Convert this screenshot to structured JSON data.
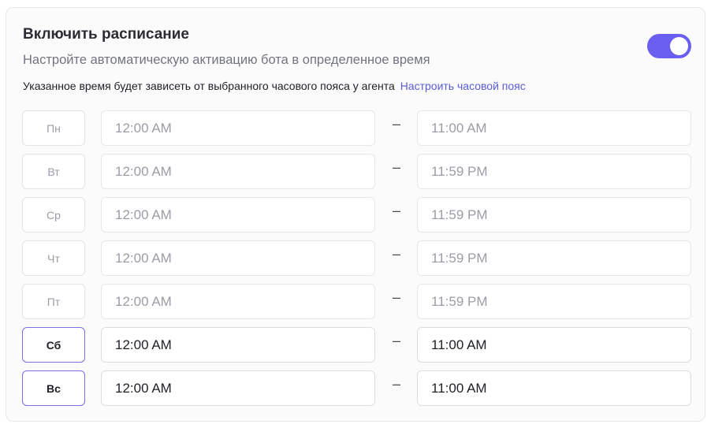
{
  "schedule": {
    "title": "Включить расписание",
    "subtitle": "Настройте автоматическую активацию бота в определенное время",
    "hint": "Указанное время будет зависеть от выбранного часового пояса у агента",
    "hint_link": "Настроить часовой пояс",
    "enabled": true,
    "accent_color": "#6a5ff0",
    "separator": "–",
    "days": [
      {
        "label": "Пн",
        "start": "12:00 AM",
        "end": "11:00 AM",
        "active": false
      },
      {
        "label": "Вт",
        "start": "12:00 AM",
        "end": "11:59 PM",
        "active": false
      },
      {
        "label": "Ср",
        "start": "12:00 AM",
        "end": "11:59 PM",
        "active": false
      },
      {
        "label": "Чт",
        "start": "12:00 AM",
        "end": "11:59 PM",
        "active": false
      },
      {
        "label": "Пт",
        "start": "12:00 AM",
        "end": "11:59 PM",
        "active": false
      },
      {
        "label": "Сб",
        "start": "12:00 AM",
        "end": "11:00 AM",
        "active": true
      },
      {
        "label": "Вс",
        "start": "12:00 AM",
        "end": "11:00 AM",
        "active": true
      }
    ]
  }
}
